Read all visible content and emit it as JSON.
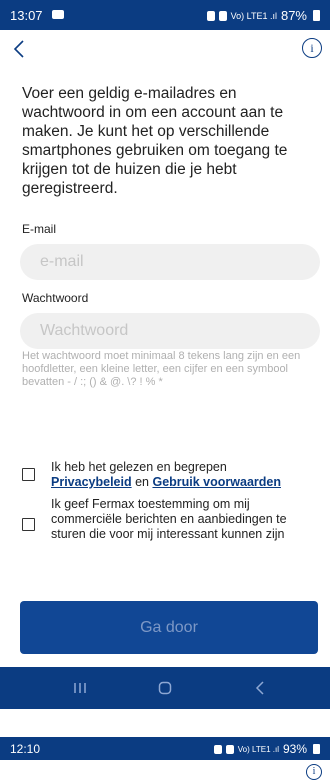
{
  "status_bar": {
    "time": "13:07",
    "network_text": "Vo) LTE1 .ıl",
    "battery": "87%"
  },
  "header": {
    "back_icon": "chevron-left-icon",
    "info_icon": "info-icon",
    "info_glyph": "i"
  },
  "intro_text": "Voer een geldig e-mailadres en wachtwoord in om een account aan te maken. Je kunt het op verschillende smartphones gebruiken om toegang te krijgen tot de huizen die je hebt geregistreerd.",
  "form": {
    "email_label": "E-mail",
    "email_placeholder": "e-mail",
    "email_value": "",
    "password_label": "Wachtwoord",
    "password_placeholder": "Wachtwoord",
    "password_value": "",
    "password_hint": "Het wachtwoord moet minimaal 8 tekens lang zijn en een hoofdletter, een kleine letter, een cijfer en een symbool bevatten - / :; () & @. \\? ! % *"
  },
  "consents": [
    {
      "checked": false,
      "text_before": "Ik heb het gelezen en begrepen ",
      "link1": "Privacybeleid",
      "text_middle": " en ",
      "link2": "Gebruik voorwaarden"
    },
    {
      "checked": false,
      "text": "Ik geef Fermax toestemming om mij commerciële berichten en aanbiedingen te sturen die voor mij interessant kunnen zijn"
    }
  ],
  "primary_button": "Ga door",
  "system_nav": {
    "recents_icon": "recents-icon",
    "home_icon": "home-icon",
    "back_icon": "back-icon"
  },
  "status_bar_2": {
    "time": "12:10",
    "network_text": "Vo) LTE1 .ıl",
    "battery": "93%"
  },
  "colors": {
    "brand_blue": "#0b3c82",
    "button_blue": "#114795",
    "link_blue": "#0b3c82",
    "field_bg": "#f0f0f0",
    "placeholder": "#c6c6c6",
    "hint_text": "#b0b0b0"
  }
}
